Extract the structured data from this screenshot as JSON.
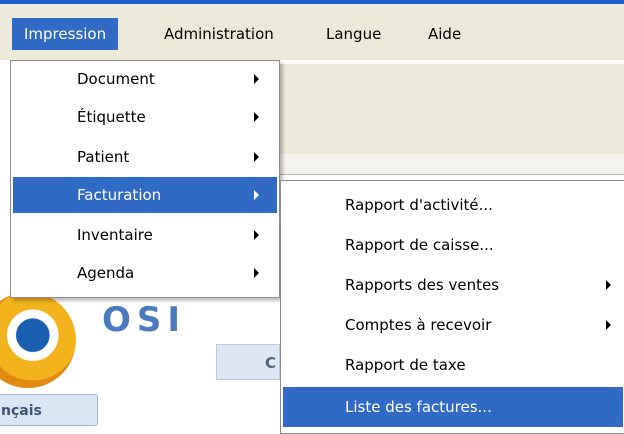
{
  "menubar": {
    "items": [
      {
        "label": "Impression"
      },
      {
        "label": "Administration"
      },
      {
        "label": "Langue"
      },
      {
        "label": "Aide"
      }
    ]
  },
  "impression_menu": {
    "items": [
      {
        "label": "Document"
      },
      {
        "label": "Étiquette"
      },
      {
        "label": "Patient"
      },
      {
        "label": "Facturation"
      },
      {
        "label": "Inventaire"
      },
      {
        "label": "Agenda"
      }
    ]
  },
  "facturation_submenu": {
    "items": [
      {
        "label": "Rapport d'activité..."
      },
      {
        "label": "Rapport de caisse..."
      },
      {
        "label": "Rapports des ventes"
      },
      {
        "label": "Comptes à recevoir"
      },
      {
        "label": "Rapport de taxe"
      },
      {
        "label": "Liste des factures..."
      }
    ]
  },
  "background": {
    "logo_text": "OSI",
    "button_c": "C",
    "language_button": "nçais"
  },
  "colors": {
    "highlight": "#316ac5",
    "menubar": "#ece9d8"
  }
}
